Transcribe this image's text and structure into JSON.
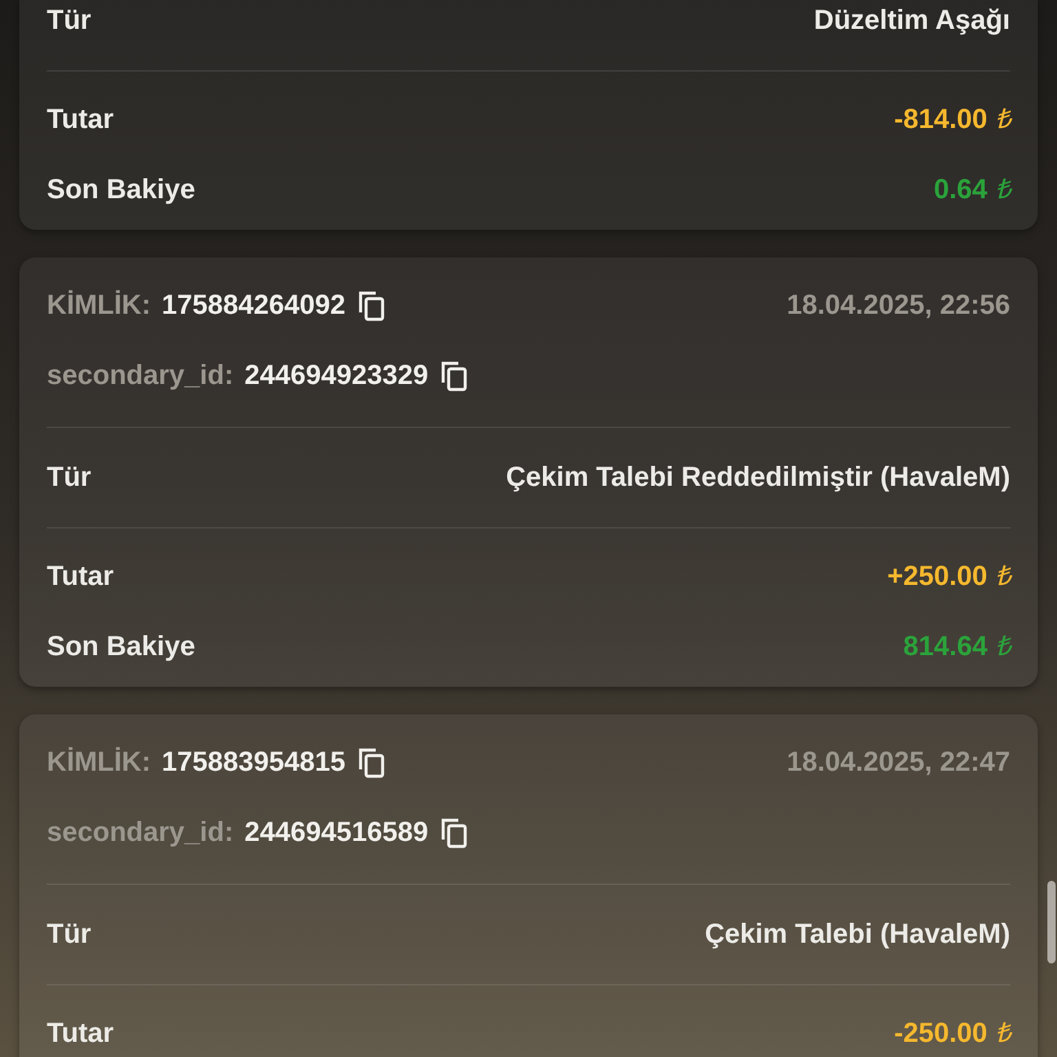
{
  "transactions": [
    {
      "type_label": "Tür",
      "type": "Düzeltim Aşağı",
      "amounts": [
        {
          "label": "Tutar",
          "value": "-814.00",
          "currency": "₺",
          "color": "#f5b82e"
        },
        {
          "label": "Son Bakiye",
          "value": "0.64",
          "currency": "₺",
          "color": "#2ba33b"
        }
      ]
    },
    {
      "id_label": "KİMLİK:",
      "id": "175884264092",
      "date": "18.04.2025, 22:56",
      "secondary_label": "secondary_id:",
      "secondary_id": "244694923329",
      "type_label": "Tür",
      "type": "Çekim Talebi Reddedilmiştir (HavaleM)",
      "amounts": [
        {
          "label": "Tutar",
          "value": "+250.00",
          "currency": "₺",
          "color": "#f5b82e"
        },
        {
          "label": "Son Bakiye",
          "value": "814.64",
          "currency": "₺",
          "color": "#2ba33b"
        }
      ]
    },
    {
      "id_label": "KİMLİK:",
      "id": "175883954815",
      "date": "18.04.2025, 22:47",
      "secondary_label": "secondary_id:",
      "secondary_id": "244694516589",
      "type_label": "Tür",
      "type": "Çekim Talebi (HavaleM)",
      "amounts": [
        {
          "label": "Tutar",
          "value": "-250.00",
          "currency": "₺",
          "color": "#f5b82e"
        }
      ]
    }
  ]
}
